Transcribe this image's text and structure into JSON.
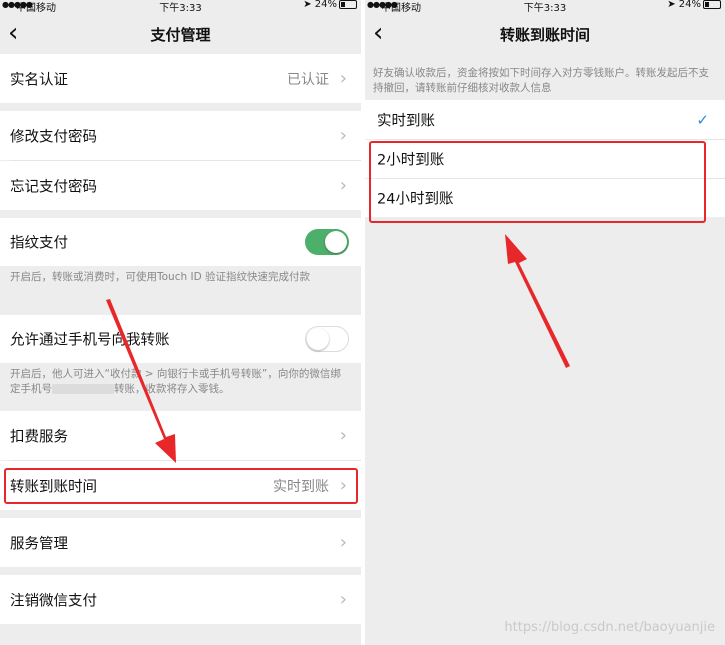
{
  "statusbar": {
    "signal": "●●●●●",
    "carrier": "中国移动",
    "time": "下午3:33",
    "battery": "24%"
  },
  "left": {
    "nav": {
      "back": "‹",
      "title": "支付管理"
    },
    "real_name": {
      "label": "实名认证",
      "value": "已认证"
    },
    "change_password": {
      "label": "修改支付密码"
    },
    "forgot_password": {
      "label": "忘记支付密码"
    },
    "fingerprint": {
      "label": "指纹支付",
      "enabled": true,
      "note": "开启后，转账或消费时，可使用Touch ID 验证指纹快速完成付款"
    },
    "phone_transfer": {
      "label": "允许通过手机号向我转账",
      "enabled": false,
      "note_before": "开启后，他人可进入“收付款 > 向银行卡或手机号转账”，向你的微信绑定手机号",
      "note_after": "转账，收款将存入零钱。"
    },
    "deduction_service": {
      "label": "扣费服务"
    },
    "transfer_time": {
      "label": "转账到账时间",
      "value": "实时到账"
    },
    "service_manage": {
      "label": "服务管理"
    },
    "cancel_pay": {
      "label": "注销微信支付"
    }
  },
  "right": {
    "nav": {
      "back": "‹",
      "title": "转账到账时间"
    },
    "description": "好友确认收款后，资金将按如下时间存入对方零钱账户。转账发起后不支持撤回，请转账前仔细核对收款人信息",
    "options": [
      {
        "label": "实时到账",
        "selected": true
      },
      {
        "label": "2小时到账",
        "selected": false
      },
      {
        "label": "24小时到账",
        "selected": false
      }
    ],
    "check_mark": "✓"
  },
  "watermark": "https://blog.csdn.net/baoyuanjie",
  "colors": {
    "highlight_red": "#e8272a",
    "toggle_green": "#4caf6a",
    "check_blue": "#2f8de0",
    "background": "#ededed"
  }
}
